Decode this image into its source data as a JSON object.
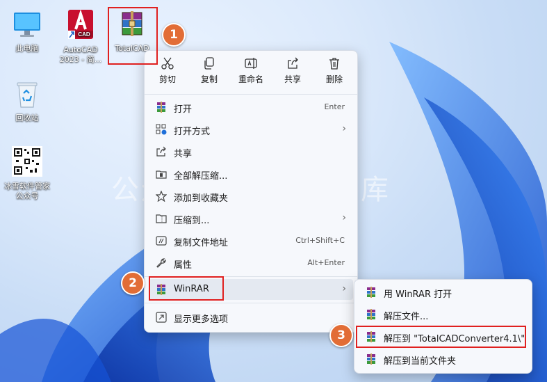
{
  "desktop": {
    "icons": [
      {
        "name": "此电脑",
        "icon": "monitor-icon"
      },
      {
        "name": "AutoCAD\n2023 - 简...",
        "icon": "autocad-icon"
      },
      {
        "name": "TotalCAD",
        "icon": "winrar-archive-icon"
      },
      {
        "name": "回收站",
        "icon": "recycle-bin-icon"
      },
      {
        "name": "冰雪软件管家\n公众号",
        "icon": "qr-code-icon"
      }
    ],
    "watermark": "公众号 ❄ 冰雪软件库"
  },
  "context_menu": {
    "toolbar": [
      {
        "label": "剪切",
        "icon": "scissors-icon"
      },
      {
        "label": "复制",
        "icon": "copy-icon"
      },
      {
        "label": "重命名",
        "icon": "rename-icon"
      },
      {
        "label": "共享",
        "icon": "share-icon"
      },
      {
        "label": "删除",
        "icon": "trash-icon"
      }
    ],
    "items": [
      {
        "label": "打开",
        "shortcut": "Enter",
        "icon": "winrar-icon"
      },
      {
        "label": "打开方式",
        "shortcut": "",
        "icon": "open-with-icon",
        "arrow": "›"
      },
      {
        "label": "共享",
        "shortcut": "",
        "icon": "share-icon"
      },
      {
        "label": "全部解压缩...",
        "shortcut": "",
        "icon": "extract-all-icon"
      },
      {
        "label": "添加到收藏夹",
        "shortcut": "",
        "icon": "star-icon"
      },
      {
        "label": "压缩到...",
        "shortcut": "",
        "icon": "zip-folder-icon",
        "arrow": "›"
      },
      {
        "label": "复制文件地址",
        "shortcut": "Ctrl+Shift+C",
        "icon": "copy-path-icon"
      },
      {
        "label": "属性",
        "shortcut": "Alt+Enter",
        "icon": "wrench-icon"
      },
      {
        "label": "WinRAR",
        "shortcut": "",
        "icon": "winrar-icon",
        "arrow": "›"
      },
      {
        "label": "显示更多选项",
        "shortcut": "",
        "icon": "more-options-icon"
      }
    ]
  },
  "submenu": {
    "items": [
      {
        "label": "用 WinRAR 打开",
        "icon": "winrar-icon"
      },
      {
        "label": "解压文件...",
        "icon": "winrar-icon"
      },
      {
        "label": "解压到 \"TotalCADConverter4.1\\\"",
        "icon": "winrar-icon"
      },
      {
        "label": "解压到当前文件夹",
        "icon": "winrar-icon"
      }
    ]
  },
  "annotations": {
    "badges": [
      "1",
      "2",
      "3"
    ],
    "accent": "#e26d36",
    "highlight": "#e0201f"
  }
}
